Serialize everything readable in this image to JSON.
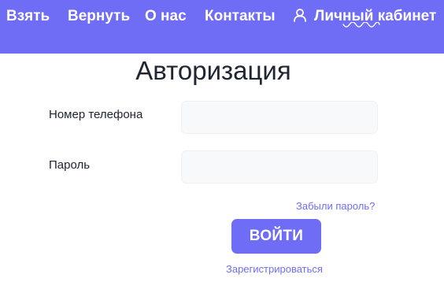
{
  "header": {
    "nav": [
      {
        "label": "Взять"
      },
      {
        "label": "Вернуть"
      },
      {
        "label": "О нас"
      },
      {
        "label": "Контакты"
      },
      {
        "label": "Личный кабинет",
        "icon": "user-icon"
      }
    ],
    "background": "#6f6cf6"
  },
  "main": {
    "title": "Авторизация",
    "phone": {
      "label": "Номер телефона",
      "value": "",
      "placeholder": ""
    },
    "password": {
      "label": "Пароль",
      "value": "",
      "placeholder": ""
    },
    "forgot_link": "Забыли пароль?",
    "login_button": "ВОЙТИ",
    "register_link": "Зарегистрироваться"
  },
  "colors": {
    "accent": "#6f6cf6",
    "text": "#1f2430",
    "input_bg": "#f8f9fb"
  }
}
